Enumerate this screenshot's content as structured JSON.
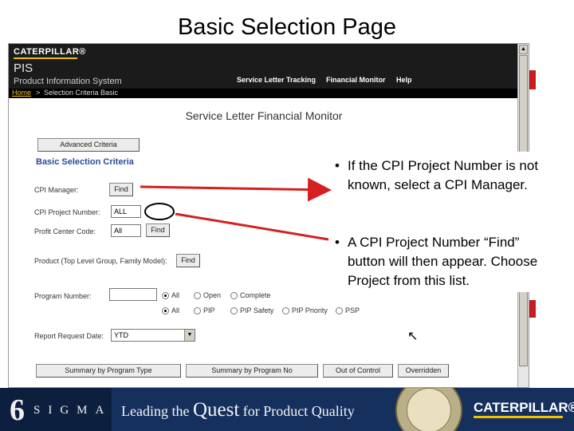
{
  "slide": {
    "title": "Basic Selection Page"
  },
  "app": {
    "brand": "CATERPILLAR®",
    "name": "PIS",
    "subtitle": "Product Information System",
    "nav": [
      "Service Letter Tracking",
      "Financial Monitor",
      "Help"
    ],
    "breadcrumb": {
      "home": "Home",
      "separator": ">",
      "current": "Selection Criteria Basic"
    }
  },
  "page": {
    "title": "Service Letter Financial Monitor",
    "advanced_button": "Advanced Criteria",
    "section_heading": "Basic Selection Criteria",
    "fields": {
      "cpi_manager": {
        "label": "CPI Manager:",
        "button": "Find"
      },
      "cpi_project_number": {
        "label": "CPI Project Number:",
        "value": "ALL"
      },
      "profit_center_code": {
        "label": "Profit Center Code:",
        "value": "All",
        "button": "Find"
      },
      "product": {
        "label": "Product (Top Level Group, Family Model):",
        "button": "Find"
      },
      "program_number": {
        "label": "Program Number:",
        "value": ""
      },
      "report_request_date": {
        "label": "Report Request Date:",
        "selected": "YTD"
      }
    },
    "status_radios": [
      {
        "label": "All",
        "checked": true
      },
      {
        "label": "Open",
        "checked": false
      },
      {
        "label": "Complete",
        "checked": false
      }
    ],
    "type_radios": [
      {
        "label": "All",
        "checked": true
      },
      {
        "label": "PIP",
        "checked": false
      },
      {
        "label": "PIP Safety",
        "checked": false
      },
      {
        "label": "PIP Priority",
        "checked": false
      },
      {
        "label": "PSP",
        "checked": false
      }
    ],
    "bottom_buttons": [
      "Summary by Program Type",
      "Summary by Program No",
      "Out of Control",
      "Overridden"
    ]
  },
  "callout": {
    "bullets": [
      "If the CPI Project Number is not known, select a CPI Manager.",
      "A CPI Project Number “Find” button will then appear. Choose Project from this list."
    ]
  },
  "banner": {
    "six": "6",
    "sigma": "SIGMA",
    "tagline_before": "Leading the ",
    "tagline_big": "Quest",
    "tagline_after": " for Product Quality",
    "brand": "CATERPILLAR®"
  },
  "colors": {
    "accent_red": "#c41e1e",
    "cat_yellow": "#f2c200",
    "link_blue": "#2a4a9a",
    "banner_blue": "#16305e"
  },
  "icons": {
    "cursor": "mouse-pointer-icon",
    "scroll_up": "triangle-up-icon",
    "dropdown": "triangle-down-icon"
  }
}
